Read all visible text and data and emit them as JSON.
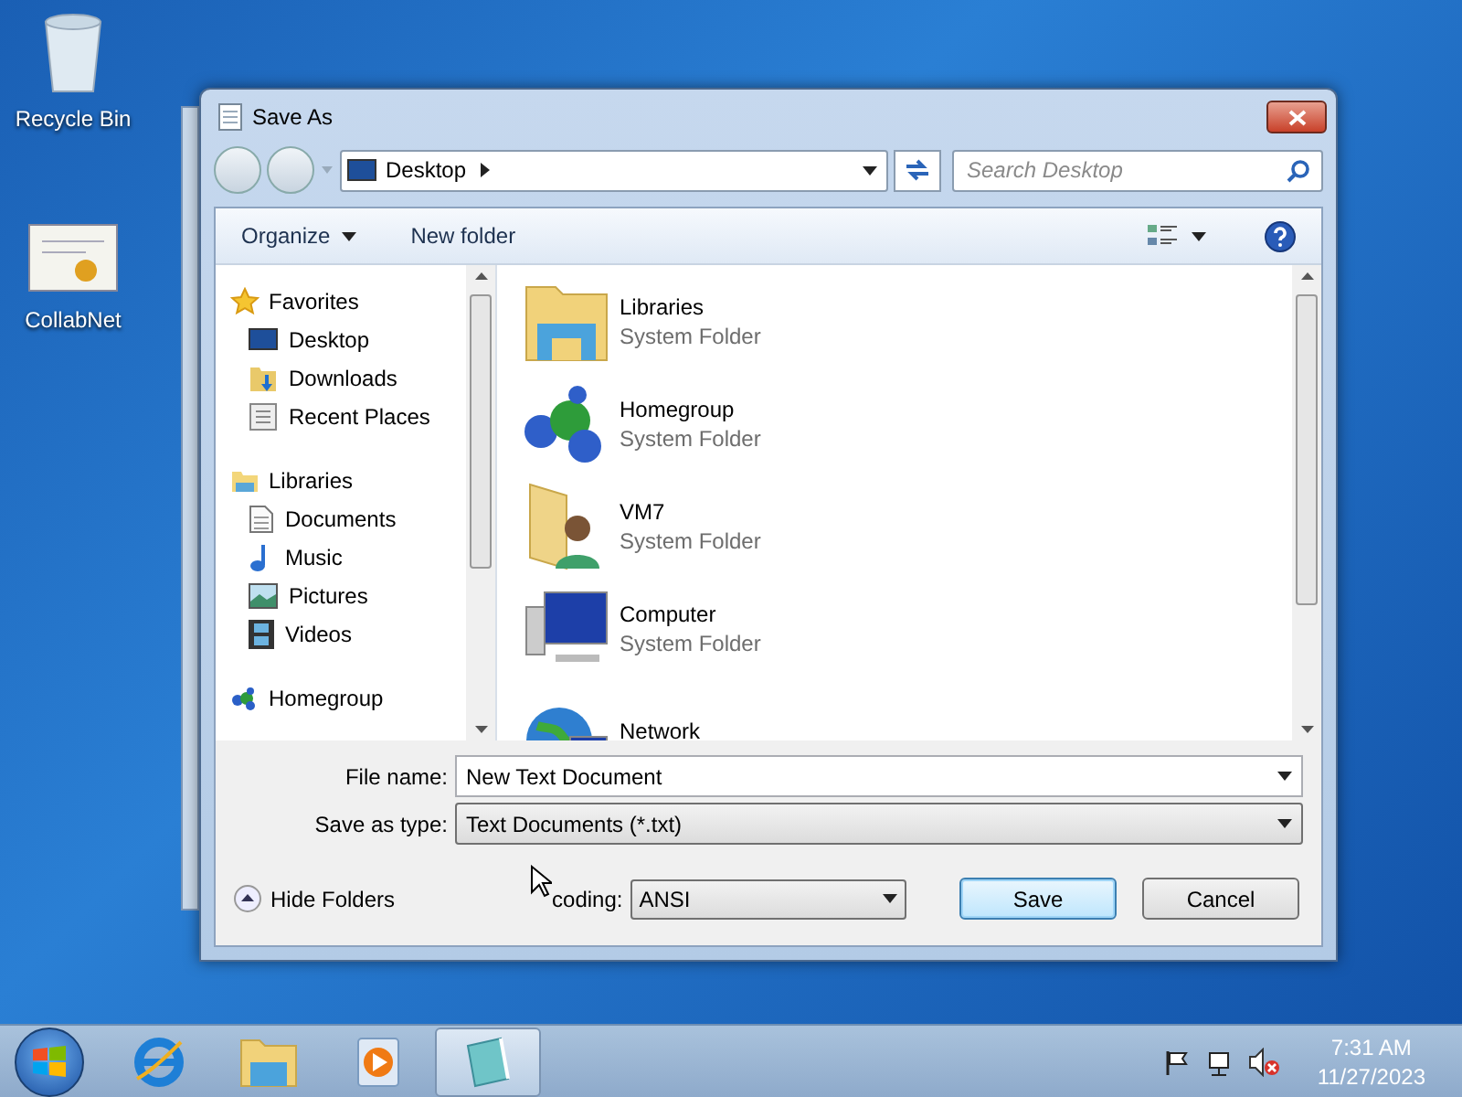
{
  "desktop_icons": [
    {
      "label": "Recycle Bin"
    },
    {
      "label": "CollabNet"
    }
  ],
  "window": {
    "title": "Save As"
  },
  "address": {
    "location": "Desktop"
  },
  "search": {
    "placeholder": "Search Desktop"
  },
  "toolbar": [
    {
      "label": "Organize",
      "kind": "menu"
    },
    {
      "label": "New folder",
      "kind": "button"
    }
  ],
  "navigation": [
    {
      "label": "Favorites",
      "children": [
        {
          "label": "Desktop"
        },
        {
          "label": "Downloads"
        },
        {
          "label": "Recent Places"
        }
      ]
    },
    {
      "label": "Libraries",
      "children": [
        {
          "label": "Documents"
        },
        {
          "label": "Music"
        },
        {
          "label": "Pictures"
        },
        {
          "label": "Videos"
        }
      ]
    },
    {
      "label": "Homegroup"
    }
  ],
  "items": [
    {
      "name": "Libraries",
      "type": "System Folder"
    },
    {
      "name": "Homegroup",
      "type": "System Folder"
    },
    {
      "name": "VM7",
      "type": "System Folder"
    },
    {
      "name": "Computer",
      "type": "System Folder"
    },
    {
      "name": "Network"
    }
  ],
  "file_name": {
    "label": "File name:",
    "value": "New Text Document"
  },
  "save_as_type": {
    "label": "Save as type:",
    "value": "Text Documents (*.txt)"
  },
  "hide_folders": "Hide Folders",
  "encoding": {
    "label": "coding:",
    "value": "ANSI"
  },
  "buttons": [
    {
      "label": "Save",
      "default": true
    },
    {
      "label": "Cancel",
      "default": false
    }
  ],
  "taskbar": {
    "apps": [
      {
        "selected": false
      },
      {
        "selected": false
      },
      {
        "selected": false
      },
      {
        "selected": true
      }
    ],
    "time": "7:31 AM",
    "date": "11/27/2023"
  }
}
